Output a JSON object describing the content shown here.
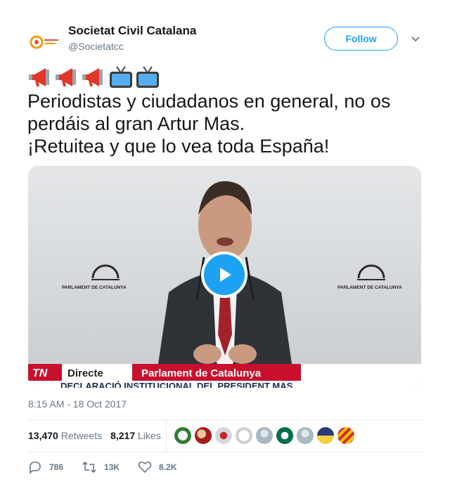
{
  "tweet": {
    "author_name": "Societat Civil Catalana",
    "author_handle": "@Societatcc",
    "follow_label": "Follow",
    "emojis": [
      "megaphone",
      "megaphone",
      "megaphone",
      "tv",
      "tv"
    ],
    "text": "Periodistas y ciudadanos en general, no os perdáis al gran Artur Mas.\n¡Retuitea y que lo vea toda España!",
    "timestamp": "8:15 AM - 18 Oct 2017"
  },
  "video": {
    "podium_text": "PARLAMENT DE CATALUNYA",
    "podium_text_right": "PARLAMENT DE CATALUNYA",
    "channel_logo": "TN",
    "live_label": "Directe",
    "location_label": "Parlament de Catalunya",
    "ticker": "DECLARACIÓ INSTITUCIONAL DEL PRESIDENT MAS"
  },
  "stats": {
    "retweets_count": "13,470",
    "retweets_label": "Retweets",
    "likes_count": "8,217",
    "likes_label": "Likes"
  },
  "actions": {
    "reply_count": "786",
    "retweet_count": "13K",
    "like_count": "8.2K"
  },
  "colors": {
    "accent": "#1da1f2",
    "muted": "#657786",
    "divider": "#e6ecf0"
  }
}
